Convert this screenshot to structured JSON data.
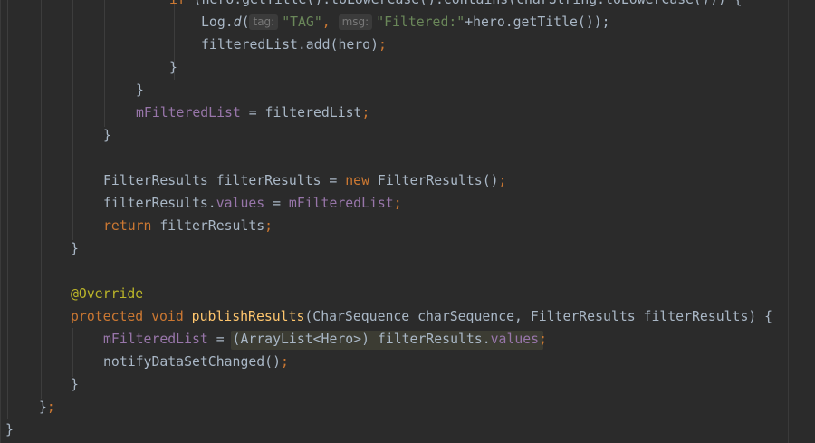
{
  "editor": {
    "lines": {
      "if_cond": {
        "kw": "if",
        "text": " (hero.getTitle().toLowerCase().contains(charString.toLowerCase())) {"
      },
      "log": {
        "cls": "Log.",
        "method": "d",
        "open": "(",
        "hint_tag": "tag:",
        "tag_value": "\"TAG\"",
        "sep": ", ",
        "hint_msg": "msg:",
        "msg_value": "\"Filtered:\"",
        "rest": "+hero.getTitle());"
      },
      "add": {
        "text": "filteredList.add(hero)",
        "semi": ";"
      },
      "close_if": "}",
      "close_loop": "}",
      "assign": {
        "field": "mFilteredList",
        "rest": " = filteredList",
        "semi": ";"
      },
      "close_else": "}",
      "new_results": {
        "a": "FilterResults filterResults = ",
        "kw": "new",
        "b": " FilterResults()",
        "semi": ";"
      },
      "values_assign": {
        "a": "filterResults.",
        "field1": "values",
        "b": " = ",
        "field2": "mFilteredList",
        "semi": ";"
      },
      "ret": {
        "kw": "return",
        "rest": " filterResults",
        "semi": ";"
      },
      "close_perform": "}",
      "annotation": "@Override",
      "publish_sig": {
        "kw1": "protected",
        "kw2": "void",
        "name": "publishResults",
        "params": "(CharSequence charSequence, FilterResults filterResults) {"
      },
      "cast_assign": {
        "field": "mFilteredList",
        "eq": " = ",
        "cast": "(ArrayList<Hero>) filterResults.",
        "field2": "values",
        "semi": ";"
      },
      "notify": {
        "text": "notifyDataSetChanged()",
        "semi": ";"
      },
      "close_publish": "}",
      "close_filter": {
        "brace": "}",
        "semi": ";"
      },
      "close_class": "}"
    }
  },
  "colors": {
    "background": "#2b2b2b",
    "default_text": "#a9b7c6",
    "keyword": "#cc7832",
    "field": "#9876aa",
    "string": "#6a8759",
    "method_decl": "#ffc66d",
    "annotation": "#bbb529"
  }
}
